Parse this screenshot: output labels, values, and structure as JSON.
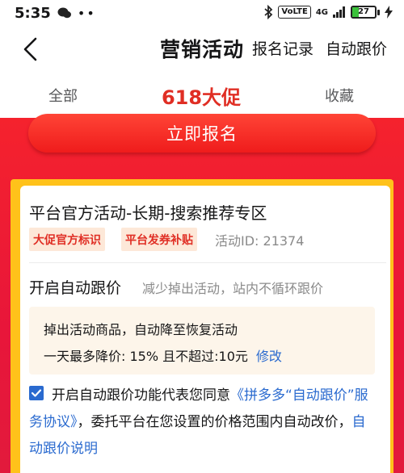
{
  "status_bar": {
    "time": "5:35",
    "left_icons": "••",
    "network_badge": "VoLTE",
    "network_type": "4G",
    "battery_level": "27",
    "battery_fraction": 0.27
  },
  "nav": {
    "title": "营销活动",
    "action_records": "报名记录",
    "action_auto_price": "自动跟价"
  },
  "tabs": [
    {
      "label": "全部",
      "active": false
    },
    {
      "label": "618大促",
      "active": true
    },
    {
      "label": "收藏",
      "active": false
    }
  ],
  "cta": {
    "label": "立即报名"
  },
  "card": {
    "title": "平台官方活动-长期-搜索推荐专区",
    "tags": [
      "大促官方标识",
      "平台发券补贴"
    ],
    "activity_id": "活动ID: 21374",
    "auto_follow_title": "开启自动跟价",
    "auto_follow_desc": "减少掉出活动，站内不循环跟价",
    "info_line1": "掉出活动商品，自动降至恢复活动",
    "info_line2": "一天最多降价: 15%  且不超过:10元",
    "edit_link": "修改",
    "agreement_checked": true,
    "agreement_prefix": "开启自动跟价功能代表您同意",
    "agreement_link": "《拼多多“自动跟价”服务协议》",
    "agreement_middle": "，委托平台在您设置的价格范围内自动改价，",
    "agreement_help_link": "自动跟价说明"
  },
  "colors": {
    "brand_red": "#e02e24",
    "link_blue": "#2a6acf",
    "frame_yellow": "#ffc21a"
  }
}
